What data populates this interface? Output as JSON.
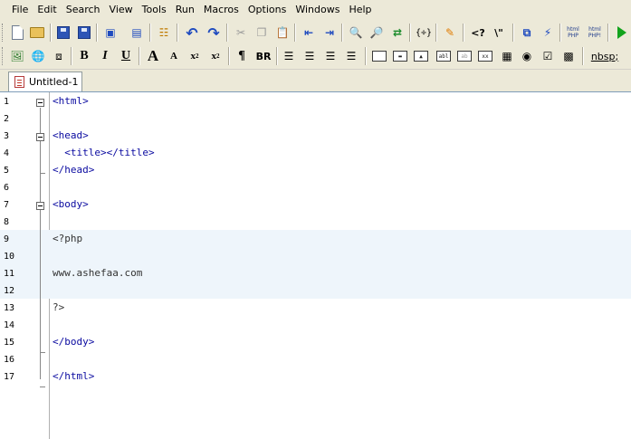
{
  "menu": [
    "File",
    "Edit",
    "Search",
    "View",
    "Tools",
    "Run",
    "Macros",
    "Options",
    "Windows",
    "Help"
  ],
  "toolbar_labels": {
    "bold": "B",
    "italic": "I",
    "underline": "U",
    "font_larger": "A",
    "font_smaller": "A",
    "subscript": "x",
    "superscript": "x",
    "subscript_mark": "2",
    "superscript_mark": "2",
    "paragraph": "¶",
    "line_break": "BR",
    "nbsp": "nbsp;",
    "php_tag": "<?",
    "escape": "\\\"",
    "html_php_1": "html PHP",
    "html_php_2": "html PHP!"
  },
  "tab": {
    "label": "Untitled-1"
  },
  "editor": {
    "lines": [
      {
        "n": "1",
        "text": "<html>",
        "cls": "c-tag"
      },
      {
        "n": "2",
        "text": "",
        "cls": ""
      },
      {
        "n": "3",
        "text": "<head>",
        "cls": "c-tag"
      },
      {
        "n": "4",
        "text": "  <title></title>",
        "cls": "c-tag"
      },
      {
        "n": "5",
        "text": "</head>",
        "cls": "c-tag"
      },
      {
        "n": "6",
        "text": "",
        "cls": ""
      },
      {
        "n": "7",
        "text": "<body>",
        "cls": "c-tag"
      },
      {
        "n": "8",
        "text": "",
        "cls": ""
      },
      {
        "n": "9",
        "text": "<?php",
        "cls": "c-php"
      },
      {
        "n": "10",
        "text": "",
        "cls": ""
      },
      {
        "n": "11",
        "text": "www.ashefaa.com",
        "cls": "c-php"
      },
      {
        "n": "12",
        "text": "",
        "cls": ""
      },
      {
        "n": "13",
        "text": "?>",
        "cls": "c-php"
      },
      {
        "n": "14",
        "text": "",
        "cls": ""
      },
      {
        "n": "15",
        "text": "</body>",
        "cls": "c-tag"
      },
      {
        "n": "16",
        "text": "",
        "cls": ""
      },
      {
        "n": "17",
        "text": "</html>",
        "cls": "c-tag"
      }
    ]
  },
  "colors": {
    "highlight": "#eef5fb",
    "tag": "#0a0aa0",
    "chrome": "#ece9d8"
  }
}
